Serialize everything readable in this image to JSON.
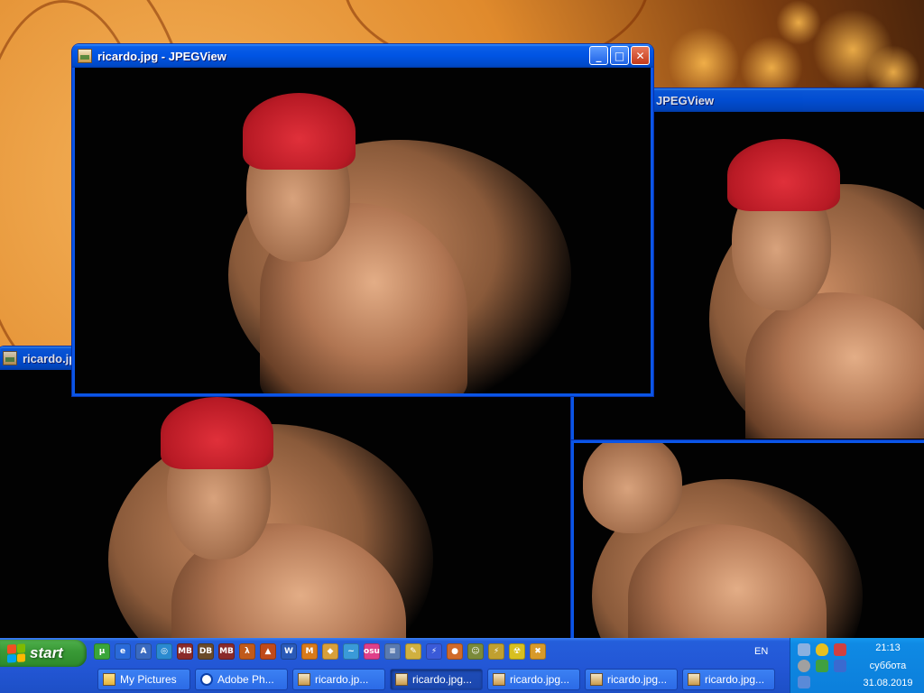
{
  "windows": {
    "front": {
      "title": "ricardo.jpg - JPEGView"
    },
    "back_right": {
      "title_partial": "JPEGView"
    },
    "back_left": {
      "title_partial": "ricardo.jpg"
    }
  },
  "title_buttons": {
    "minimize": "_",
    "maximize": "□",
    "close": "✕"
  },
  "taskbar": {
    "start_label": "start",
    "quick_launch": [
      {
        "name": "utorrent-icon",
        "glyph": "μ",
        "color": "#3aa63a"
      },
      {
        "name": "ie-icon",
        "glyph": "e",
        "color": "#2a6ad8"
      },
      {
        "name": "font-icon",
        "glyph": "A",
        "color": "#3a6ac0"
      },
      {
        "name": "browser-icon",
        "glyph": "◎",
        "color": "#2a8ad0"
      },
      {
        "name": "game-icon",
        "glyph": "MB",
        "color": "#8a2a2a"
      },
      {
        "name": "dosbox-icon",
        "glyph": "DB",
        "color": "#6a4a2a"
      },
      {
        "name": "game2-icon",
        "glyph": "MB",
        "color": "#8a2a2a"
      },
      {
        "name": "halflife-icon",
        "glyph": "λ",
        "color": "#c05a1a"
      },
      {
        "name": "launcher-icon",
        "glyph": "▲",
        "color": "#c04a1a"
      },
      {
        "name": "word-icon",
        "glyph": "W",
        "color": "#2a5ab8"
      },
      {
        "name": "mcafee-icon",
        "glyph": "M",
        "color": "#d87a1a"
      },
      {
        "name": "tool-icon",
        "glyph": "◆",
        "color": "#d8a03a"
      },
      {
        "name": "bird-icon",
        "glyph": "~",
        "color": "#3a9ad8"
      },
      {
        "name": "osu-icon",
        "glyph": "osu",
        "color": "#e0408a"
      },
      {
        "name": "notepad-icon",
        "glyph": "≡",
        "color": "#5a7ab0"
      },
      {
        "name": "image-icon",
        "glyph": "✎",
        "color": "#d0b040"
      },
      {
        "name": "winamp-icon",
        "glyph": "⚡",
        "color": "#3a5ad8"
      },
      {
        "name": "media-icon",
        "glyph": "●",
        "color": "#d06a2a"
      },
      {
        "name": "face-icon",
        "glyph": "☺",
        "color": "#7a8a3a"
      },
      {
        "name": "plugin-icon",
        "glyph": "⚡",
        "color": "#c0a030"
      },
      {
        "name": "radiation-icon",
        "glyph": "☢",
        "color": "#d8c020"
      },
      {
        "name": "tools-icon",
        "glyph": "✖",
        "color": "#d89a2a"
      }
    ],
    "language": "EN",
    "tasks": [
      {
        "label": "My Pictures",
        "icon": "folder"
      },
      {
        "label": "Adobe Ph...",
        "icon": "ps"
      },
      {
        "label": "ricardo.jp...",
        "icon": "img"
      },
      {
        "label": "ricardo.jpg...",
        "icon": "img",
        "active": true
      },
      {
        "label": "ricardo.jpg...",
        "icon": "img"
      },
      {
        "label": "ricardo.jpg...",
        "icon": "img"
      },
      {
        "label": "ricardo.jpg...",
        "icon": "img"
      }
    ],
    "clock": {
      "time": "21:13",
      "day": "суббота",
      "date": "31.08.2019"
    }
  }
}
